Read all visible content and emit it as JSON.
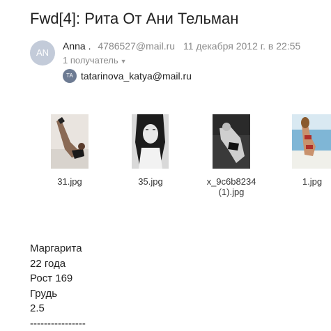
{
  "message": {
    "subject": "Fwd[4]: Рита От Ани Тельман",
    "sender": {
      "avatar_initials": "AN",
      "name": "Anna .",
      "email": "4786527@mail.ru",
      "date": "11 декабря 2012 г. в 22:55"
    },
    "recipients_toggle": "1 получатель",
    "recipient": {
      "avatar_initials": "TA",
      "email": "tatarinova_katya@mail.ru"
    }
  },
  "attachments": [
    {
      "name": "31.jpg"
    },
    {
      "name": "35.jpg"
    },
    {
      "name_line1": "x_9c6b8234",
      "name_line2": "(1).jpg"
    },
    {
      "name": "1.jpg"
    }
  ],
  "body_lines": [
    "Маргарита",
    "22 года",
    "Рост 169",
    "Грудь",
    "2.5",
    "----------------"
  ],
  "colors": {
    "avatar_bg": "#c3cbd9",
    "recipient_avatar_bg": "#6d7b93",
    "muted_text": "#8a8a8a"
  }
}
